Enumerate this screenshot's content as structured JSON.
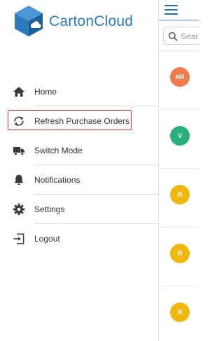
{
  "brand": {
    "name": "CartonCloud",
    "colors": {
      "primary": "#2c7bbf",
      "cube_dark": "#1f5e99",
      "cube_light": "#4a97d4",
      "highlight_border": "#e0332e"
    }
  },
  "drawer": {
    "items": [
      {
        "label": "Home",
        "icon": "home-icon"
      },
      {
        "label": "Refresh Purchase Orders",
        "icon": "refresh-icon",
        "highlighted": true
      },
      {
        "label": "Switch Mode",
        "icon": "truck-icon"
      },
      {
        "label": "Notifications",
        "icon": "bell-icon"
      },
      {
        "label": "Settings",
        "icon": "gear-icon"
      },
      {
        "label": "Logout",
        "icon": "logout-icon"
      }
    ]
  },
  "background_app": {
    "menu_icon": "hamburger-icon",
    "search": {
      "placeholder": "Search"
    },
    "rows": [
      {
        "initials": "NR",
        "color": "#f07a4b"
      },
      {
        "initials": "V",
        "color": "#27b07a"
      },
      {
        "initials": "R",
        "color": "#efb80e"
      },
      {
        "initials": "R",
        "color": "#efb80e"
      },
      {
        "initials": "R",
        "color": "#efb80e"
      }
    ]
  }
}
